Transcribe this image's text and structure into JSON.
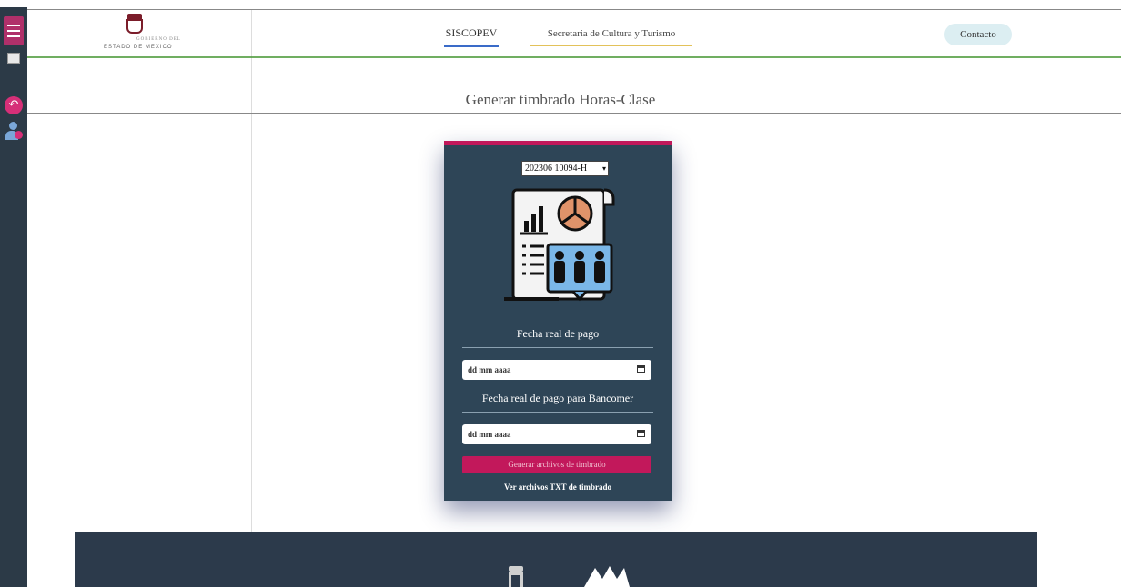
{
  "header": {
    "logo_line1": "GOBIERNO DEL",
    "logo_line2": "ESTADO DE MEXICO",
    "nav": [
      {
        "label": "SISCOPEV"
      },
      {
        "label": "Secretaria de Cultura y Turismo"
      }
    ],
    "contact_label": "Contacto"
  },
  "page": {
    "title": "Generar timbrado Horas-Clase"
  },
  "form": {
    "period_select": "202306 10094-H",
    "fecha_pago_label": "Fecha real de pago",
    "fecha_pago_placeholder": "dd mm aaaa",
    "fecha_bancomer_label": "Fecha real de pago para Bancomer",
    "fecha_bancomer_placeholder": "dd mm aaaa",
    "generate_button": "Generar archivos de timbrado",
    "view_link": "Ver archivos TXT de timbrado"
  },
  "colors": {
    "accent": "#c2185b",
    "card_bg": "#2e4557",
    "sidebar_bg": "#2c3a47",
    "footer_bg": "#2c3a4b",
    "nav_active": "#3a6bc8",
    "nav_secondary": "#e3c25a"
  }
}
